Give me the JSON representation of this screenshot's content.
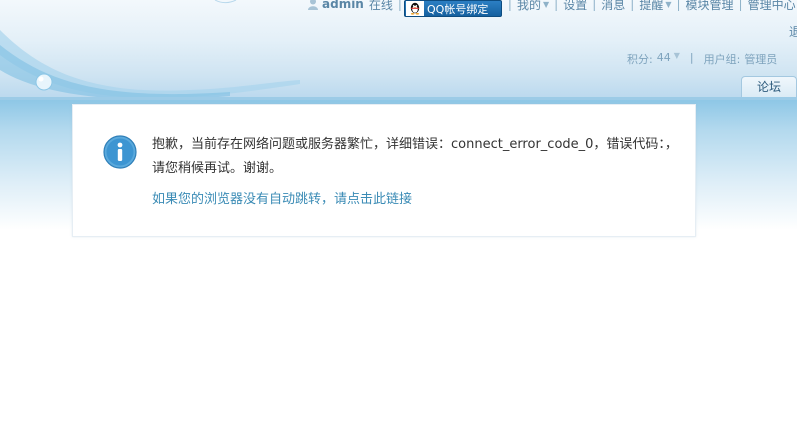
{
  "topbar": {
    "username": "admin",
    "status": "在线",
    "qq_bind_label": "QQ帐号绑定",
    "links": [
      "我的",
      "设置",
      "消息",
      "提醒",
      "模块管理",
      "管理中心"
    ]
  },
  "header": {
    "right_edge_text": "退",
    "credits_label": "积分:",
    "credits_value": "44",
    "usergroup_label": "用户组:",
    "usergroup_value": "管理员"
  },
  "nav": {
    "forum_tab": "论坛"
  },
  "message": {
    "text": "抱歉，当前存在网络问题或服务器繁忙，详细错误：connect_error_code_0，错误代码：，请您稍候再试。谢谢。",
    "redirect_link": "如果您的浏览器没有自动跳转，请点击此链接"
  },
  "colors": {
    "accent": "#3a8bb5",
    "header_blue": "#9ccbe7",
    "qq_button": "#1a6aae"
  },
  "icons": [
    "user-icon",
    "qq-penguin-icon",
    "info-icon"
  ]
}
